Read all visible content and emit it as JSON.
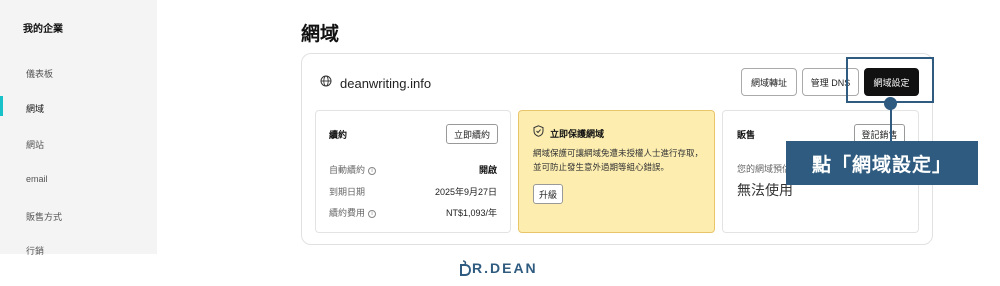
{
  "sidebar": {
    "company": "我的企業",
    "items": [
      {
        "label": "儀表板"
      },
      {
        "label": "網域"
      },
      {
        "label": "網站"
      },
      {
        "label": "email"
      },
      {
        "label": "販售方式"
      },
      {
        "label": "行銷"
      }
    ],
    "active_index": 1
  },
  "page_title": "網域",
  "domain": {
    "icon": "globe-icon",
    "name": "deanwriting.info",
    "buttons": {
      "transfer": "網域轉址",
      "dns": "管理 DNS",
      "settings": "網域設定"
    }
  },
  "renewal": {
    "title": "續約",
    "renew_button": "立即續約",
    "rows": [
      {
        "label": "自動續約",
        "value": "開啟"
      },
      {
        "label": "到期日期",
        "value": "2025年9月27日"
      },
      {
        "label": "續約費用",
        "value": "NT$1,093/年"
      }
    ]
  },
  "protection": {
    "icon": "shield-check-icon",
    "title": "立即保護網域",
    "text": "網域保護可讓網域免遭未授權人士進行存取，並可防止發生意外過期等組心錯誤。",
    "upgrade_button": "升級"
  },
  "sale": {
    "title": "販售",
    "register_button": "登記銷售",
    "label": "您的網域預估",
    "value": "無法使用"
  },
  "annotation": {
    "callout": "點「網域設定」"
  },
  "logo": {
    "text": "R.DEAN"
  },
  "colors": {
    "accent": "#2e5b7f",
    "active_indicator": "#19c2c8",
    "protection_bg": "#fdeeb0"
  }
}
